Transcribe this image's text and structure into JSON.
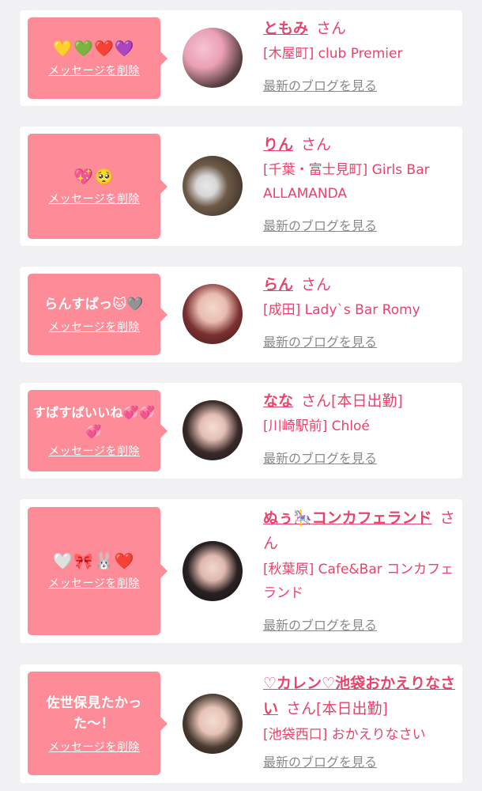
{
  "delete_label": "メッセージを削除",
  "blog_label": "最新のブログを見る",
  "honorific": "さん",
  "cards": [
    {
      "message": "💛💚❤️💜",
      "name": "ともみ",
      "status": "",
      "shop": "[木屋町] club Premier"
    },
    {
      "message": "💖🥺",
      "name": "りん",
      "status": "",
      "shop": "[千葉・富士見町] Girls Bar ALLAMANDA"
    },
    {
      "message": "らんすぱっ🐱🩶",
      "name": "らん",
      "status": "",
      "shop": "[成田] Lady`s Bar Romy"
    },
    {
      "message": "すぱすぱいいね💞💞💞",
      "name": "なな",
      "status": "[本日出勤]",
      "shop": "[川崎駅前] Chloé"
    },
    {
      "message": "🤍🎀🐰❤️",
      "name": "ぬぅ🎠コンカフェランド",
      "status": "",
      "shop": "[秋葉原] Cafe&Bar コンカフェランド"
    },
    {
      "message": "佐世保見たかった〜！",
      "name": "♡カレン♡池袋おかえりなさい",
      "status": "[本日出勤]",
      "shop": "[池袋西口] おかえりなさい"
    }
  ],
  "colors": {
    "bubble": "#fd8c98",
    "accent": "#e8436b",
    "link_gray": "#8a8a8a",
    "background": "#f1f1f3"
  }
}
